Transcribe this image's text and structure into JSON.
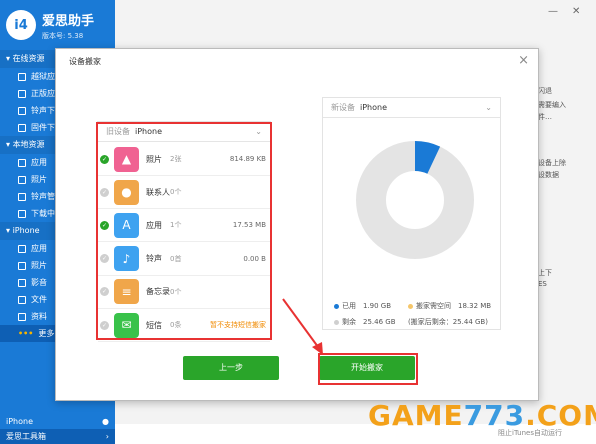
{
  "app": {
    "logo_mark": "i4",
    "title": "爱思助手",
    "version": "版本号: 5.38"
  },
  "sidebar": {
    "online_section": "在线资源",
    "online_items": [
      "越狱应",
      "正版应",
      "铃声下",
      "固件下"
    ],
    "local_section": "本地资源",
    "local_items": [
      "应用",
      "照片",
      "铃声管",
      "下载中"
    ],
    "iphone_section": "iPhone",
    "iphone_items": [
      "应用",
      "照片",
      "影音",
      "文件",
      "资料",
      "更多"
    ],
    "bottom_device": "iPhone",
    "bottom_toolbox": "爱思工具箱"
  },
  "window": {
    "minimize": "—",
    "close": "✕"
  },
  "right_texts": [
    "闪退",
    "需要编入",
    "件…",
    "设备上除",
    "设数据",
    "上下",
    "ES"
  ],
  "bottom_tip": "阻止iTunes自动运行",
  "dialog": {
    "title": "设备搬家",
    "close": "×",
    "old_device_label": "旧设备",
    "old_device_name": "iPhone",
    "new_device_label": "新设备",
    "new_device_name": "iPhone",
    "items": [
      {
        "name": "照片",
        "count": "2张",
        "size": "814.89 KB",
        "checked": true,
        "color": "#f06292",
        "icon": "▲"
      },
      {
        "name": "联系人",
        "count": "0个",
        "size": "",
        "checked": false,
        "color": "#f0a64a",
        "icon": "●"
      },
      {
        "name": "应用",
        "count": "1个",
        "size": "17.53 MB",
        "checked": true,
        "color": "#3ea2f0",
        "icon": "A"
      },
      {
        "name": "铃声",
        "count": "0首",
        "size": "0.00 B",
        "checked": false,
        "color": "#3ea2f0",
        "icon": "♪"
      },
      {
        "name": "备忘录",
        "count": "0个",
        "size": "",
        "checked": false,
        "color": "#f0a64a",
        "icon": "≡"
      },
      {
        "name": "短信",
        "count": "0条",
        "size": "",
        "warn": "暂不支持短信搬家",
        "checked": false,
        "color": "#39c24a",
        "icon": "✉"
      }
    ],
    "storage": {
      "used_label": "已用",
      "used_value": "1.90 GB",
      "need_label": "搬家需空间",
      "need_value": "18.32 MB",
      "free_label": "剩余",
      "free_value": "25.46 GB",
      "after_label": "(搬家后剩余：25.44 GB)",
      "used_fraction": 0.07,
      "colors": {
        "used": "#1a7ad6",
        "need": "#f5c66a",
        "free": "#e4e4e4"
      }
    },
    "prev_button": "上一步",
    "start_button": "开始搬家"
  },
  "watermark": {
    "part1": "GAME",
    "part2": "773",
    "part3": ".COM"
  }
}
